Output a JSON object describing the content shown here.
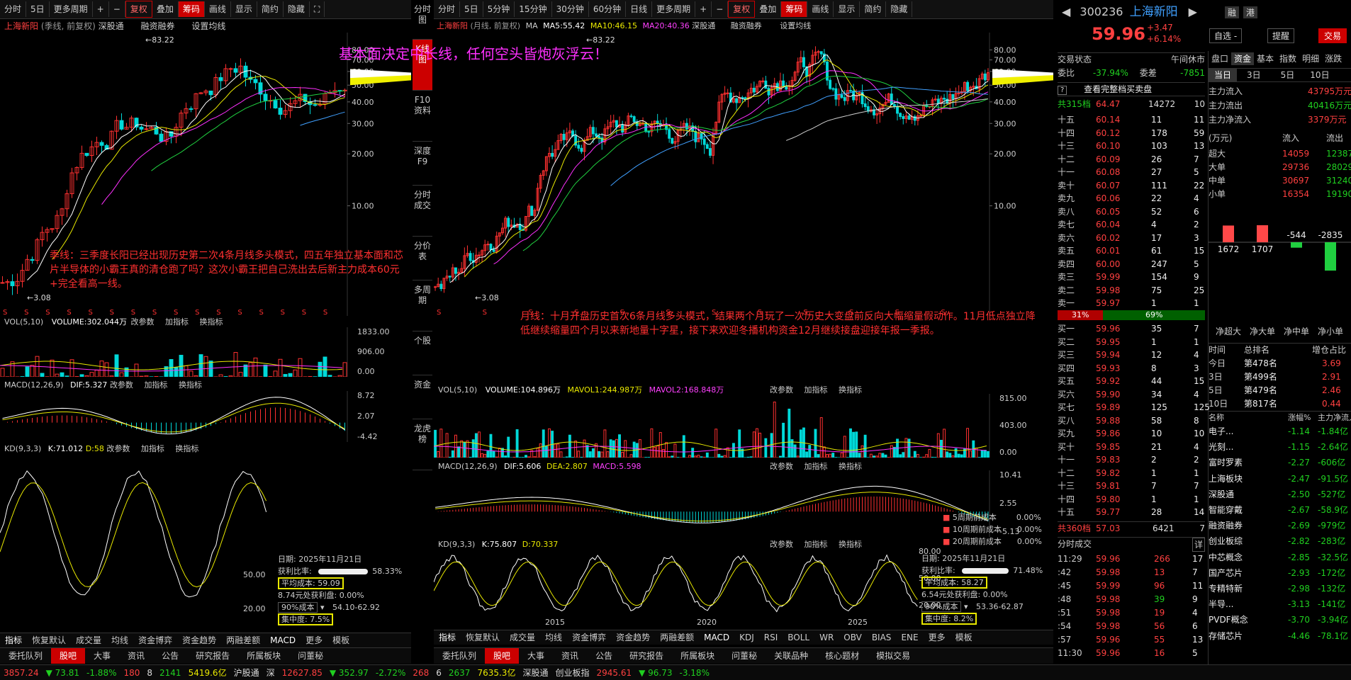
{
  "left": {
    "toolbar": [
      "分时",
      "5日",
      "更多周期",
      "+",
      "−",
      "复权",
      "叠加",
      "筹码",
      "画线",
      "显示",
      "简约",
      "隐藏"
    ],
    "title": "上海新阳",
    "subtitle": "(季线, 前复权)",
    "links": [
      "深股通",
      "融资融券",
      "设置均线"
    ],
    "yticks": [
      "80.00",
      "70.00",
      "60.00",
      "50.00",
      "40.00",
      "30.00",
      "20.00",
      "10.00"
    ],
    "high": "83.22",
    "low": "3.08",
    "vol_label": "VOL(5,10)",
    "vol_value": "VOLUME:302.044万",
    "vol_ticks": [
      "1833.00",
      "906.00",
      "0.00"
    ],
    "macd_label": "MACD(12,26,9)",
    "macd_value": "DIF:5.327",
    "macd_ticks": [
      "8.72",
      "2.07",
      "-4.42"
    ],
    "kd_label": "KD(9,3,3)",
    "kd_k": "K:71.012",
    "kd_d": "D:58",
    "kd_ticks": [
      "50.00",
      "20.00"
    ],
    "pane_links": [
      "改参数",
      "加指标",
      "换指标"
    ],
    "annotation": "季线：三季度长阳已经出现历史第二次4条月线多头模式，四五年独立基本面和芯片半导体的小霸王真的清仓跑了吗？这次小霸王把自己洗出去后新主力成本60元+完全看高一线。",
    "chip": {
      "date": "日期: 2025年11月21日",
      "profit_label": "获利比率:",
      "profit_value": "58.33%",
      "avg_cost": "平均成本: 59.09",
      "profit_at": "8.74元处获利盘: 0.00%",
      "cost90": "90%成本",
      "cost90_range": "54.10-62.92",
      "concentration": "集中度: 7.5%"
    },
    "bottom_tabs": [
      "指标",
      "恢复默认",
      "成交量",
      "均线",
      "资金博弈",
      "资金趋势",
      "两融差额",
      "MACD",
      "更多",
      "模板"
    ]
  },
  "banner": "基本面决定中长线，任何空头皆炮灰浮云！",
  "vtabs": [
    "分时图",
    "K线图",
    "F10资料",
    "深度F9",
    "分时成交",
    "分价表",
    "多周期",
    "个股",
    "资金",
    "龙虎榜"
  ],
  "mid": {
    "toolbar": [
      "分时",
      "5日",
      "5分钟",
      "15分钟",
      "30分钟",
      "60分钟",
      "日线",
      "更多周期",
      "+",
      "−",
      "复权",
      "叠加",
      "筹码",
      "画线",
      "显示",
      "简约",
      "隐藏"
    ],
    "title": "上海新阳",
    "subtitle": "(月线, 前复权)",
    "ma": "MA",
    "ma5": "MA5:55.42",
    "ma10": "MA10:46.15",
    "ma20": "MA20:40.36",
    "links": [
      "深股通",
      "融资融券",
      "设置均线"
    ],
    "yticks": [
      "80.00",
      "70.00",
      "60.00",
      "50.00",
      "40.00",
      "30.00",
      "20.00",
      "10.00"
    ],
    "high": "83.22",
    "low": "3.08",
    "vol_label": "VOL(5,10)",
    "vol_value": "VOLUME:104.896万",
    "mavol1": "MAVOL1:244.987万",
    "mavol2": "MAVOL2:168.848万",
    "vol_ticks": [
      "815.00",
      "403.00",
      "0.00"
    ],
    "macd_label": "MACD(12,26,9)",
    "macd_dif": "DIF:5.606",
    "macd_dea": "DEA:2.807",
    "macd_macd": "MACD:5.598",
    "macd_ticks": [
      "10.41",
      "2.55",
      "-5.13"
    ],
    "kd_label": "KD(9,3,3)",
    "kd_k": "K:75.807",
    "kd_d": "D:70.337",
    "kd_ticks": [
      "80.00",
      "50.00",
      "20.00"
    ],
    "pane_links": [
      "改参数",
      "加指标",
      "换指标"
    ],
    "xlabels": [
      "2015",
      "2020",
      "2025"
    ],
    "annotation": "月线：十月开盘历史首次6条月线多头模式，结果两个月玩了一次历史大变盘前反向大幅缩量假动作。11月低点独立降低继续缩量四个月以来新地量十字星，接下来欢迎冬播机构资金12月继续接盘迎接年报一季报。",
    "period_cost": [
      {
        "label": "5周期前成本",
        "value": "0.00%"
      },
      {
        "label": "10周期前成本",
        "value": "0.00%"
      },
      {
        "label": "20周期前成本",
        "value": "0.00%"
      }
    ],
    "chip": {
      "date": "日期: 2025年11月21日",
      "profit_label": "获利比率:",
      "profit_value": "71.48%",
      "avg_cost": "平均成本: 58.27",
      "profit_at": "6.54元处获利盘: 0.00%",
      "cost90": "90%成本",
      "cost90_range": "53.36-62.87",
      "concentration": "集中度: 8.2%"
    },
    "bottom_tabs": [
      "指标",
      "恢复默认",
      "成交量",
      "均线",
      "资金博弈",
      "资金趋势",
      "两融差额",
      "MACD",
      "KDJ",
      "RSI",
      "BOLL",
      "WR",
      "OBV",
      "BIAS",
      "ENE",
      "更多",
      "模板"
    ]
  },
  "bottom_nav": [
    "委托队列",
    "股吧",
    "大事",
    "资讯",
    "公告",
    "研究报告",
    "所属板块",
    "问董秘",
    "关联品种",
    "核心题材",
    "模拟交易"
  ],
  "quote": {
    "code": "300236",
    "name": "上海新阳",
    "btn1": "融",
    "btn2": "港",
    "price": "59.96",
    "change": "+3.47",
    "change_pct": "+6.14%",
    "zixuan": "自选 -",
    "tixing": "提醒",
    "jiaoyi": "交易",
    "state_label": "交易状态",
    "state_value": "午间休市",
    "weibi_label": "委比",
    "weibi_value": "-37.94%",
    "weicha_label": "委差",
    "weicha_value": "-7851",
    "view_full": "查看完整档买卖盘",
    "sell_total": {
      "label": "共315档",
      "price": "64.47",
      "vol": "14272",
      "n": "10"
    },
    "asks": [
      {
        "l": "十五",
        "p": "60.14",
        "v": "11",
        "n": "11"
      },
      {
        "l": "十四",
        "p": "60.12",
        "v": "178",
        "n": "59"
      },
      {
        "l": "十三",
        "p": "60.10",
        "v": "103",
        "n": "13"
      },
      {
        "l": "十二",
        "p": "60.09",
        "v": "26",
        "n": "7"
      },
      {
        "l": "十一",
        "p": "60.08",
        "v": "27",
        "n": "5"
      },
      {
        "l": "卖十",
        "p": "60.07",
        "v": "111",
        "n": "22"
      },
      {
        "l": "卖九",
        "p": "60.06",
        "v": "22",
        "n": "4"
      },
      {
        "l": "卖八",
        "p": "60.05",
        "v": "52",
        "n": "6"
      },
      {
        "l": "卖七",
        "p": "60.04",
        "v": "4",
        "n": "2"
      },
      {
        "l": "卖六",
        "p": "60.02",
        "v": "17",
        "n": "3"
      },
      {
        "l": "卖五",
        "p": "60.01",
        "v": "61",
        "n": "15"
      },
      {
        "l": "卖四",
        "p": "60.00",
        "v": "247",
        "n": "5"
      },
      {
        "l": "卖三",
        "p": "59.99",
        "v": "154",
        "n": "9"
      },
      {
        "l": "卖二",
        "p": "59.98",
        "v": "75",
        "n": "25"
      },
      {
        "l": "卖一",
        "p": "59.97",
        "v": "1",
        "n": "1"
      }
    ],
    "ratio_left": "31%",
    "ratio_right": "69%",
    "bids": [
      {
        "l": "买一",
        "p": "59.96",
        "v": "35",
        "n": "7"
      },
      {
        "l": "买二",
        "p": "59.95",
        "v": "1",
        "n": "1"
      },
      {
        "l": "买三",
        "p": "59.94",
        "v": "12",
        "n": "4"
      },
      {
        "l": "买四",
        "p": "59.93",
        "v": "8",
        "n": "3"
      },
      {
        "l": "买五",
        "p": "59.92",
        "v": "44",
        "n": "15"
      },
      {
        "l": "买六",
        "p": "59.90",
        "v": "34",
        "n": "4"
      },
      {
        "l": "买七",
        "p": "59.89",
        "v": "125",
        "n": "125"
      },
      {
        "l": "买八",
        "p": "59.88",
        "v": "58",
        "n": "8"
      },
      {
        "l": "买九",
        "p": "59.86",
        "v": "10",
        "n": "10"
      },
      {
        "l": "买十",
        "p": "59.85",
        "v": "21",
        "n": "4"
      },
      {
        "l": "十一",
        "p": "59.83",
        "v": "2",
        "n": "2"
      },
      {
        "l": "十二",
        "p": "59.82",
        "v": "1",
        "n": "1"
      },
      {
        "l": "十三",
        "p": "59.81",
        "v": "7",
        "n": "7"
      },
      {
        "l": "十四",
        "p": "59.80",
        "v": "1",
        "n": "1"
      },
      {
        "l": "十五",
        "p": "59.77",
        "v": "28",
        "n": "14"
      }
    ],
    "buy_total": {
      "label": "共360档",
      "price": "57.03",
      "vol": "6421",
      "n": "7"
    },
    "trades_title": "分时成交",
    "trades_more": "详",
    "trades": [
      {
        "t": "11:29",
        "p": "59.96",
        "v": "266",
        "n": "17",
        "c": "up"
      },
      {
        "t": ":42",
        "p": "59.98",
        "v": "13",
        "n": "7",
        "c": "up"
      },
      {
        "t": ":45",
        "p": "59.99",
        "v": "96",
        "n": "11",
        "c": "up"
      },
      {
        "t": ":48",
        "p": "59.98",
        "v": "39",
        "n": "9",
        "c": "dn"
      },
      {
        "t": ":51",
        "p": "59.98",
        "v": "19",
        "n": "4",
        "c": "up"
      },
      {
        "t": ":54",
        "p": "59.98",
        "v": "56",
        "n": "6",
        "c": "up"
      },
      {
        "t": ":57",
        "p": "59.96",
        "v": "55",
        "n": "13",
        "c": "up"
      },
      {
        "t": "11:30",
        "p": "59.96",
        "v": "16",
        "n": "5",
        "c": "up"
      }
    ],
    "right_tabs": [
      "盘口",
      "资金",
      "基本",
      "指数",
      "明细",
      "涨跌"
    ],
    "period_tabs": [
      "当日",
      "3日",
      "5日",
      "10日"
    ],
    "flows": [
      {
        "l": "主力流入",
        "v": "43795万元",
        "c": "up"
      },
      {
        "l": "主力流出",
        "v": "40416万元",
        "c": "dn"
      },
      {
        "l": "主力净流入",
        "v": "3379万元",
        "c": "up"
      }
    ],
    "flow_head": [
      "(万元)",
      "流入",
      "流出"
    ],
    "flow_rows": [
      {
        "l": "超大",
        "a": "14059",
        "b": "12387"
      },
      {
        "l": "大单",
        "a": "29736",
        "b": "28029"
      },
      {
        "l": "中单",
        "a": "30697",
        "b": "31240"
      },
      {
        "l": "小单",
        "a": "16354",
        "b": "19190"
      }
    ],
    "net_bars": [
      {
        "label": "净超大",
        "value": 1672
      },
      {
        "label": "净大单",
        "value": 1707
      },
      {
        "label": "净中单",
        "value": -544
      },
      {
        "label": "净小单",
        "value": -2835
      }
    ],
    "net_labels": [
      "1672",
      "1707",
      "-544",
      "-2835"
    ],
    "rank_head": [
      "时间",
      "总排名",
      "增仓占比"
    ],
    "ranks": [
      {
        "t": "今日",
        "r": "第478名",
        "v": "3.69"
      },
      {
        "t": "3日",
        "r": "第499名",
        "v": "2.91"
      },
      {
        "t": "5日",
        "r": "第479名",
        "v": "2.46"
      },
      {
        "t": "10日",
        "r": "第817名",
        "v": "0.44"
      }
    ],
    "sector_head": [
      "名称",
      "涨幅%",
      "主力净流入"
    ],
    "sectors": [
      {
        "n": "电子...",
        "a": "-1.14",
        "b": "-1.84亿"
      },
      {
        "n": "光刻...",
        "a": "-1.15",
        "b": "-2.64亿"
      },
      {
        "n": "富时罗素",
        "a": "-2.27",
        "b": "-606亿"
      },
      {
        "n": "上海板块",
        "a": "-2.47",
        "b": "-91.5亿"
      },
      {
        "n": "深股通",
        "a": "-2.50",
        "b": "-527亿"
      },
      {
        "n": "智能穿戴",
        "a": "-2.67",
        "b": "-58.9亿"
      },
      {
        "n": "融资融券",
        "a": "-2.69",
        "b": "-979亿"
      },
      {
        "n": "创业板综",
        "a": "-2.82",
        "b": "-283亿"
      },
      {
        "n": "中芯概念",
        "a": "-2.85",
        "b": "-32.5亿"
      },
      {
        "n": "国产芯片",
        "a": "-2.93",
        "b": "-172亿"
      },
      {
        "n": "专精特新",
        "a": "-2.98",
        "b": "-132亿"
      },
      {
        "n": "半导...",
        "a": "-3.13",
        "b": "-141亿"
      },
      {
        "n": "PVDF概念",
        "a": "-3.70",
        "b": "-3.94亿"
      },
      {
        "n": "存储芯片",
        "a": "-4.46",
        "b": "-78.1亿"
      }
    ]
  },
  "status": {
    "sh_val": "3857.24",
    "sh_chg": "▼ 73.81",
    "sh_pct": "-1.88%",
    "sh_up": "180",
    "sh_flat": "8",
    "sh_dn": "2141",
    "sh_amt": "5419.6亿",
    "hgt": "沪股通",
    "sz_label": "深",
    "sz_val": "12627.85",
    "sz_chg": "▼ 352.97",
    "sz_pct": "-2.72%",
    "sz_up": "268",
    "sz_flat": "6",
    "sz_dn": "2637",
    "sz_amt": "7635.3亿",
    "sgt": "深股通",
    "cyb_label": "创业板指",
    "cyb_val": "2945.61",
    "cyb_chg": "▼ 96.73",
    "cyb_pct": "-3.18%",
    "hu": "沪"
  }
}
